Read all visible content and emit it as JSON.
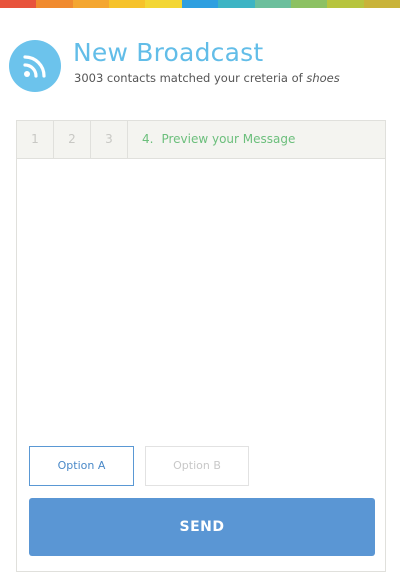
{
  "header": {
    "icon": "rss-icon",
    "title": "New Broadcast",
    "subtitle_prefix": "3003 contacts matched your creteria of ",
    "subtitle_keyword": "shoes"
  },
  "steps": {
    "step1": "1",
    "step2": "2",
    "step3": "3",
    "active_number": "4.",
    "active_label": "Preview your Message"
  },
  "options": {
    "a": "Option A",
    "b": "Option B"
  },
  "send_label": "SEND",
  "colors": {
    "accent": "#62bde8",
    "step_active": "#6cbf7c",
    "send_button": "#5a96d4",
    "option_selected_border": "#5a98d4",
    "rainbow": [
      "#e8533c",
      "#f08a2e",
      "#f4a630",
      "#f6c22a",
      "#f3d634",
      "#2e9fe0",
      "#3db4c4",
      "#6cbf9c",
      "#8cc163",
      "#b7c43e",
      "#c9b33a"
    ]
  }
}
